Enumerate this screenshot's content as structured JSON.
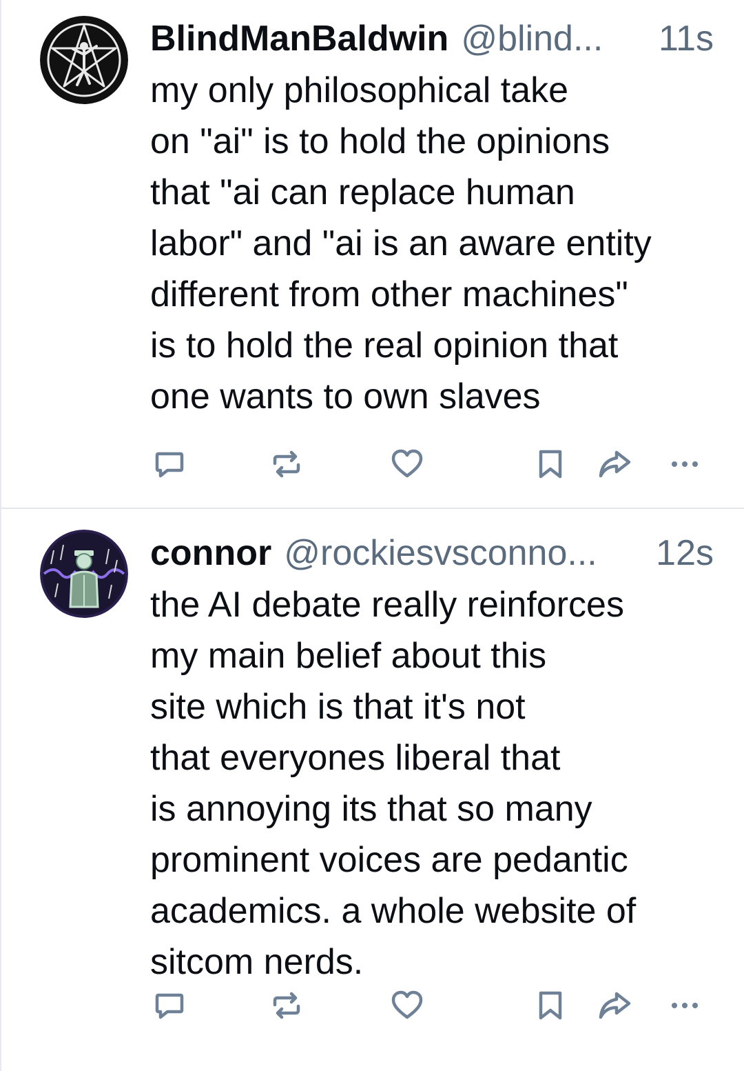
{
  "posts": [
    {
      "display_name": "BlindManBaldwin",
      "handle": "@blind...",
      "timestamp": "11s",
      "avatar_icon": "pentagram-figure-avatar",
      "text_lines": [
        "my only philosophical take",
        "on \"ai\" is to hold the opinions",
        "that \"ai can replace human",
        "labor\" and \"ai is an aware entity",
        "different from other machines\"",
        "is to hold the real opinion that",
        "one wants to own slaves"
      ]
    },
    {
      "display_name": "connor",
      "handle": "@rockiesvsconno...",
      "timestamp": "12s",
      "avatar_icon": "rainy-figure-avatar",
      "text_lines": [
        "the AI debate really reinforces",
        "my main belief about this",
        "site which is that it's not",
        "that everyones liberal that",
        "is annoying its that so many",
        "prominent voices are pedantic",
        "academics. a whole website of",
        "sitcom nerds."
      ]
    }
  ],
  "actions": [
    "reply-icon",
    "repost-icon",
    "like-icon",
    "bookmark-icon",
    "share-icon",
    "more-icon"
  ],
  "colors": {
    "text": "#0b0f14",
    "muted": "#5b6b7e",
    "icon": "#6f8196",
    "divider": "#e3e6eb"
  }
}
